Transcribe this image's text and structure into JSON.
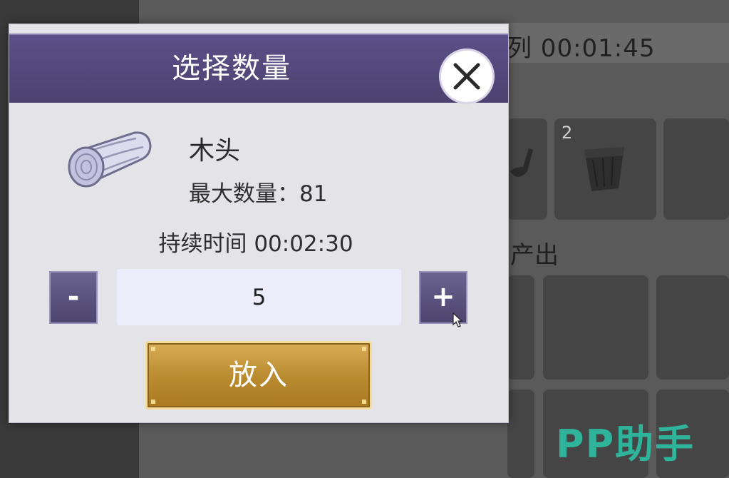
{
  "background": {
    "queue_label": "列 00:01:45",
    "output_label": "产出",
    "slot_count": "2",
    "watermark": "PP助手"
  },
  "dialog": {
    "title": "选择数量",
    "item": {
      "icon": "wood-log-icon",
      "name": "木头",
      "max_label": "最大数量：",
      "max_value": "81"
    },
    "duration_label": "持续时间",
    "duration_value": "00:02:30",
    "quantity": {
      "minus_label": "-",
      "plus_label": "+",
      "value": "5"
    },
    "confirm_label": "放入"
  },
  "colors": {
    "header": "#54497c",
    "confirm_button": "#c39338",
    "watermark": "#2fb39a"
  }
}
